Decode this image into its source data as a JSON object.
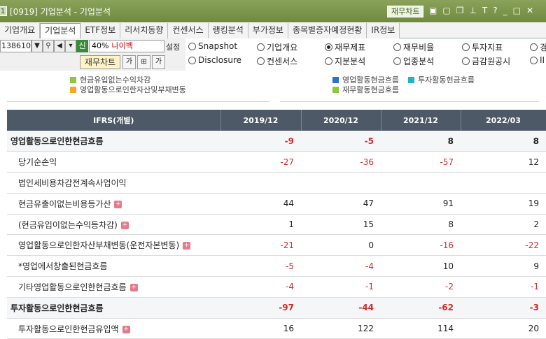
{
  "window": {
    "num_badge": "1",
    "title": "[0919] 기업분석 - 기업분석",
    "chart_button": "재무차트",
    "icons": [
      "chart-icon",
      "window-icon",
      "copy-icon",
      "pin-icon",
      "text-icon",
      "help-icon",
      "minimize-icon",
      "maximize-icon",
      "close-icon"
    ]
  },
  "tabs": [
    "기업개요",
    "기업분석",
    "ETF정보",
    "리서치동향",
    "컨센서스",
    "랭킹분석",
    "부가정보",
    "종목별증자예정현황",
    "IR정보"
  ],
  "toolbar": {
    "code": "138610",
    "sin_badge": "신",
    "pct": "40%",
    "stock_name": "나이벡",
    "setting_label": "설정",
    "chart_button": "재무차트"
  },
  "radios": [
    {
      "label": "Snapshot",
      "checked": false
    },
    {
      "label": "기업개요",
      "checked": false
    },
    {
      "label": "재무제표",
      "checked": true
    },
    {
      "label": "재무비율",
      "checked": false
    },
    {
      "label": "투자지표",
      "checked": false
    },
    {
      "label": "경",
      "checked": false
    },
    {
      "label": "Disclosure",
      "checked": false
    },
    {
      "label": "컨센서스",
      "checked": false
    },
    {
      "label": "지분분석",
      "checked": false
    },
    {
      "label": "업종분석",
      "checked": false
    },
    {
      "label": "금감원공시",
      "checked": false
    },
    {
      "label": "II",
      "checked": false
    }
  ],
  "legend_left": [
    {
      "label": "현금유입없는수익차감",
      "color": "#8dc63f"
    },
    {
      "label": "영업활동으로인한자산및부채변동",
      "color": "#f5a623"
    }
  ],
  "legend_right": [
    {
      "label": "영업활동현금흐름",
      "color": "#2d6fd6"
    },
    {
      "label": "투자활동현금흐름",
      "color": "#1fb5c9"
    },
    {
      "label": "재무활동현금흐름",
      "color": "#8dc63f"
    }
  ],
  "table": {
    "header": [
      "IFRS(개별)",
      "2019/12",
      "2020/12",
      "2021/12",
      "2022/03"
    ],
    "rows": [
      {
        "label": "영업활동으로인한현금흐름",
        "bold": true,
        "plus": false,
        "values": [
          "-9",
          "-5",
          "8",
          "8"
        ]
      },
      {
        "label": "당기순손익",
        "bold": false,
        "plus": false,
        "values": [
          "-27",
          "-36",
          "-57",
          "12"
        ]
      },
      {
        "label": "법인세비용차감전계속사업이익",
        "bold": false,
        "plus": false,
        "values": [
          "",
          "",
          "",
          ""
        ]
      },
      {
        "label": "현금유출이없는비용등가산",
        "bold": false,
        "plus": true,
        "values": [
          "44",
          "47",
          "91",
          "19"
        ]
      },
      {
        "label": "(현금유입이없는수익등차감)",
        "bold": false,
        "plus": true,
        "values": [
          "1",
          "15",
          "8",
          "2"
        ]
      },
      {
        "label": "영업활동으로인한자산부채변동(운전자본변동)",
        "bold": false,
        "plus": true,
        "values": [
          "-21",
          "0",
          "-16",
          "-22"
        ]
      },
      {
        "label": "*영업에서창출된현금흐름",
        "bold": false,
        "plus": false,
        "values": [
          "-5",
          "-4",
          "10",
          "9"
        ]
      },
      {
        "label": "기타영업활동으로인한현금흐름",
        "bold": false,
        "plus": true,
        "values": [
          "-4",
          "-1",
          "-2",
          "-1"
        ]
      },
      {
        "label": "투자활동으로인한현금흐름",
        "bold": true,
        "plus": false,
        "values": [
          "-97",
          "-44",
          "-62",
          "-3"
        ]
      },
      {
        "label": "투자활동으로인한현금유입액",
        "bold": false,
        "plus": true,
        "values": [
          "16",
          "122",
          "114",
          "20"
        ]
      }
    ]
  }
}
